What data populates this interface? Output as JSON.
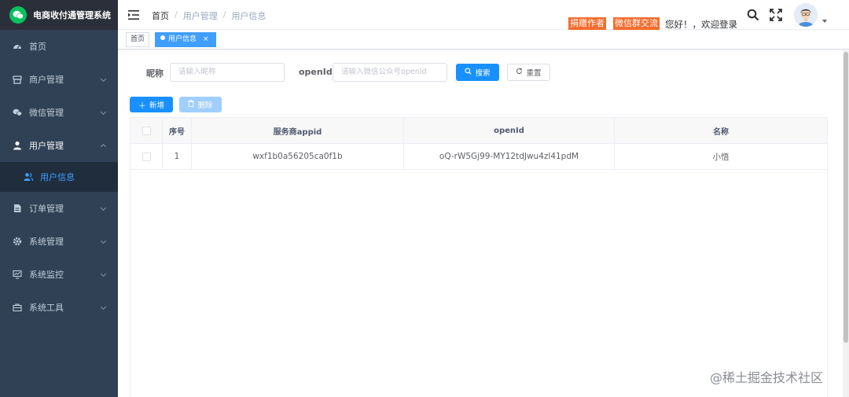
{
  "app": {
    "title": "电商收付通管理系统"
  },
  "sidebar": {
    "items": [
      {
        "label": "首页",
        "icon": "dashboard-icon"
      },
      {
        "label": "商户管理",
        "icon": "merchant-icon"
      },
      {
        "label": "微信管理",
        "icon": "wechat-icon"
      },
      {
        "label": "用户管理",
        "icon": "user-icon"
      },
      {
        "label": "用户信息",
        "icon": "peoples-icon"
      },
      {
        "label": "订单管理",
        "icon": "order-icon"
      },
      {
        "label": "系统管理",
        "icon": "system-icon"
      },
      {
        "label": "系统监控",
        "icon": "monitor-icon"
      },
      {
        "label": "系统工具",
        "icon": "tool-icon"
      }
    ]
  },
  "header": {
    "breadcrumb": [
      "首页",
      "用户管理",
      "用户信息"
    ],
    "separator": "/",
    "donate_label": "捐赠作者",
    "wechat_group_label": "微信群交流",
    "greeting": "您好！，欢迎登录"
  },
  "tags_view": {
    "home": "首页",
    "active": "用户信息",
    "close": "×"
  },
  "search": {
    "nickname_label": "昵称",
    "nickname_placeholder": "请输入昵称",
    "openid_label": "openId",
    "openid_placeholder": "请输入微信公众号openId",
    "search_button": "搜索",
    "reset_button": "重置"
  },
  "toolbar": {
    "add_button": "新增",
    "delete_button": "删除"
  },
  "table": {
    "columns": [
      "序号",
      "服务商appid",
      "openId",
      "名称"
    ],
    "rows": [
      {
        "index": "1",
        "appid": "wxf1b0a56205ca0f1b",
        "openid": "oQ-rW5Gj99-MY12tdJwu4zl41pdM",
        "name": "小悟"
      }
    ]
  },
  "watermark": "@稀土掘金技术社区",
  "colors": {
    "sidebar_bg": "#304156",
    "primary": "#1890ff",
    "tag_orange": "#f56c2d",
    "active_menu": "#409eff"
  }
}
